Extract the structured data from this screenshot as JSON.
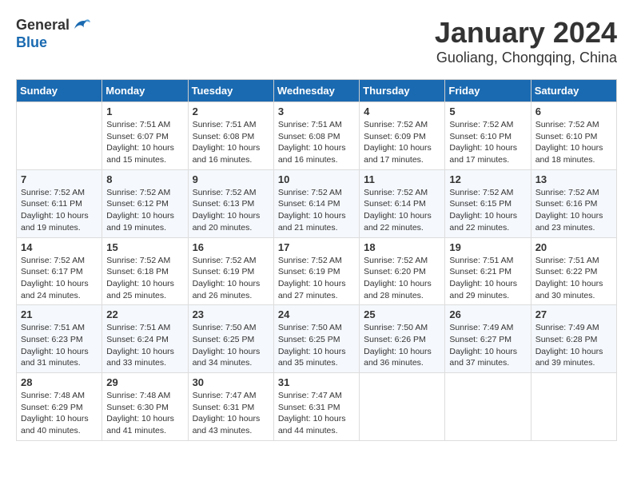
{
  "header": {
    "logo_general": "General",
    "logo_blue": "Blue",
    "month_title": "January 2024",
    "location": "Guoliang, Chongqing, China"
  },
  "days_of_week": [
    "Sunday",
    "Monday",
    "Tuesday",
    "Wednesday",
    "Thursday",
    "Friday",
    "Saturday"
  ],
  "weeks": [
    [
      {
        "day": "",
        "info": ""
      },
      {
        "day": "1",
        "info": "Sunrise: 7:51 AM\nSunset: 6:07 PM\nDaylight: 10 hours\nand 15 minutes."
      },
      {
        "day": "2",
        "info": "Sunrise: 7:51 AM\nSunset: 6:08 PM\nDaylight: 10 hours\nand 16 minutes."
      },
      {
        "day": "3",
        "info": "Sunrise: 7:51 AM\nSunset: 6:08 PM\nDaylight: 10 hours\nand 16 minutes."
      },
      {
        "day": "4",
        "info": "Sunrise: 7:52 AM\nSunset: 6:09 PM\nDaylight: 10 hours\nand 17 minutes."
      },
      {
        "day": "5",
        "info": "Sunrise: 7:52 AM\nSunset: 6:10 PM\nDaylight: 10 hours\nand 17 minutes."
      },
      {
        "day": "6",
        "info": "Sunrise: 7:52 AM\nSunset: 6:10 PM\nDaylight: 10 hours\nand 18 minutes."
      }
    ],
    [
      {
        "day": "7",
        "info": "Sunrise: 7:52 AM\nSunset: 6:11 PM\nDaylight: 10 hours\nand 19 minutes."
      },
      {
        "day": "8",
        "info": "Sunrise: 7:52 AM\nSunset: 6:12 PM\nDaylight: 10 hours\nand 19 minutes."
      },
      {
        "day": "9",
        "info": "Sunrise: 7:52 AM\nSunset: 6:13 PM\nDaylight: 10 hours\nand 20 minutes."
      },
      {
        "day": "10",
        "info": "Sunrise: 7:52 AM\nSunset: 6:14 PM\nDaylight: 10 hours\nand 21 minutes."
      },
      {
        "day": "11",
        "info": "Sunrise: 7:52 AM\nSunset: 6:14 PM\nDaylight: 10 hours\nand 22 minutes."
      },
      {
        "day": "12",
        "info": "Sunrise: 7:52 AM\nSunset: 6:15 PM\nDaylight: 10 hours\nand 22 minutes."
      },
      {
        "day": "13",
        "info": "Sunrise: 7:52 AM\nSunset: 6:16 PM\nDaylight: 10 hours\nand 23 minutes."
      }
    ],
    [
      {
        "day": "14",
        "info": "Sunrise: 7:52 AM\nSunset: 6:17 PM\nDaylight: 10 hours\nand 24 minutes."
      },
      {
        "day": "15",
        "info": "Sunrise: 7:52 AM\nSunset: 6:18 PM\nDaylight: 10 hours\nand 25 minutes."
      },
      {
        "day": "16",
        "info": "Sunrise: 7:52 AM\nSunset: 6:19 PM\nDaylight: 10 hours\nand 26 minutes."
      },
      {
        "day": "17",
        "info": "Sunrise: 7:52 AM\nSunset: 6:19 PM\nDaylight: 10 hours\nand 27 minutes."
      },
      {
        "day": "18",
        "info": "Sunrise: 7:52 AM\nSunset: 6:20 PM\nDaylight: 10 hours\nand 28 minutes."
      },
      {
        "day": "19",
        "info": "Sunrise: 7:51 AM\nSunset: 6:21 PM\nDaylight: 10 hours\nand 29 minutes."
      },
      {
        "day": "20",
        "info": "Sunrise: 7:51 AM\nSunset: 6:22 PM\nDaylight: 10 hours\nand 30 minutes."
      }
    ],
    [
      {
        "day": "21",
        "info": "Sunrise: 7:51 AM\nSunset: 6:23 PM\nDaylight: 10 hours\nand 31 minutes."
      },
      {
        "day": "22",
        "info": "Sunrise: 7:51 AM\nSunset: 6:24 PM\nDaylight: 10 hours\nand 33 minutes."
      },
      {
        "day": "23",
        "info": "Sunrise: 7:50 AM\nSunset: 6:25 PM\nDaylight: 10 hours\nand 34 minutes."
      },
      {
        "day": "24",
        "info": "Sunrise: 7:50 AM\nSunset: 6:25 PM\nDaylight: 10 hours\nand 35 minutes."
      },
      {
        "day": "25",
        "info": "Sunrise: 7:50 AM\nSunset: 6:26 PM\nDaylight: 10 hours\nand 36 minutes."
      },
      {
        "day": "26",
        "info": "Sunrise: 7:49 AM\nSunset: 6:27 PM\nDaylight: 10 hours\nand 37 minutes."
      },
      {
        "day": "27",
        "info": "Sunrise: 7:49 AM\nSunset: 6:28 PM\nDaylight: 10 hours\nand 39 minutes."
      }
    ],
    [
      {
        "day": "28",
        "info": "Sunrise: 7:48 AM\nSunset: 6:29 PM\nDaylight: 10 hours\nand 40 minutes."
      },
      {
        "day": "29",
        "info": "Sunrise: 7:48 AM\nSunset: 6:30 PM\nDaylight: 10 hours\nand 41 minutes."
      },
      {
        "day": "30",
        "info": "Sunrise: 7:47 AM\nSunset: 6:31 PM\nDaylight: 10 hours\nand 43 minutes."
      },
      {
        "day": "31",
        "info": "Sunrise: 7:47 AM\nSunset: 6:31 PM\nDaylight: 10 hours\nand 44 minutes."
      },
      {
        "day": "",
        "info": ""
      },
      {
        "day": "",
        "info": ""
      },
      {
        "day": "",
        "info": ""
      }
    ]
  ]
}
